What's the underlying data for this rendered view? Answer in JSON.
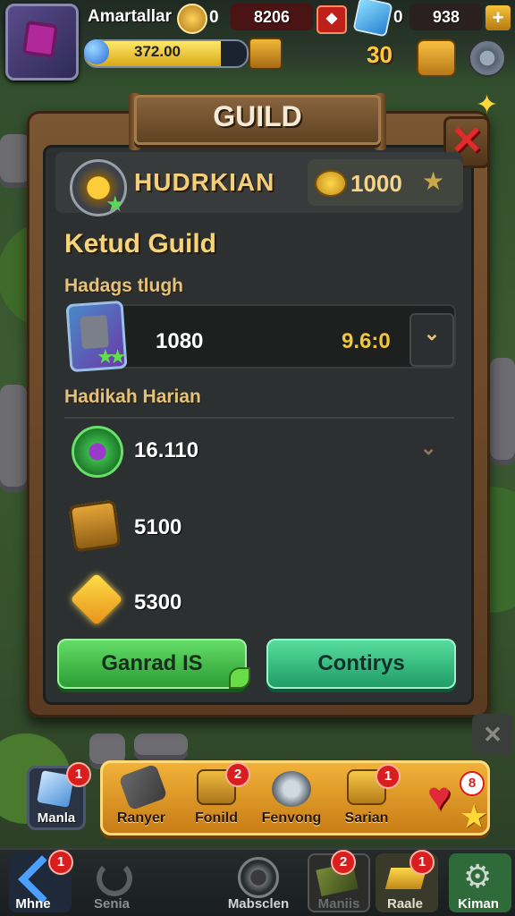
{
  "top": {
    "player_name": "Amartallar",
    "level_badge": "0",
    "gold_top": "8206",
    "gem_count": "0",
    "gem_total": "938",
    "xp_text": "372.00",
    "gold_secondary": "30"
  },
  "panel": {
    "title": "GUILD",
    "guild_name": "HUDRKIAN",
    "guild_coins": "1000",
    "section_title": "Ketud Guild",
    "member_label": "Hadags tlugh",
    "member_value": "1080",
    "member_score": "9.6:0",
    "rewards_label": "Hadikah Harian",
    "rewards": [
      {
        "icon": "emerald-orb-icon",
        "value": "16.110"
      },
      {
        "icon": "treasure-chest-icon",
        "value": "5100"
      },
      {
        "icon": "gold-gem-icon",
        "value": "5300"
      }
    ],
    "button_primary": "Ganrad IS",
    "button_secondary": "Contirys"
  },
  "action_bar": {
    "mania": {
      "label": "Manla",
      "badge": "1"
    },
    "items": [
      {
        "label": "Ranyer",
        "icon": "sword-icon",
        "badge": ""
      },
      {
        "label": "Fonild",
        "icon": "chest-icon",
        "badge": "2"
      },
      {
        "label": "Fenvong",
        "icon": "helmet-icon",
        "badge": ""
      },
      {
        "label": "Sarian",
        "icon": "loot-box-icon",
        "badge": "1"
      }
    ],
    "heart_badge": "8"
  },
  "bottom_nav": [
    {
      "label": "Mhne",
      "icon": "arrow-icon",
      "badge": "1"
    },
    {
      "label": "Senia",
      "icon": "refresh-icon",
      "badge": ""
    },
    {
      "label": "Mabsclen",
      "icon": "portal-icon",
      "badge": ""
    },
    {
      "label": "Maniis",
      "icon": "map-icon",
      "badge": "2"
    },
    {
      "label": "Raale",
      "icon": "gold-bar-icon",
      "badge": "1"
    },
    {
      "label": "Kiman",
      "icon": "gear-icon",
      "badge": ""
    }
  ],
  "colors": {
    "accent_gold": "#f5c33a",
    "panel_wood": "#6a4828",
    "button_green": "#3ab84a",
    "button_teal": "#2ab878",
    "close_red": "#e22a2a"
  },
  "xp_progress": 0.84
}
